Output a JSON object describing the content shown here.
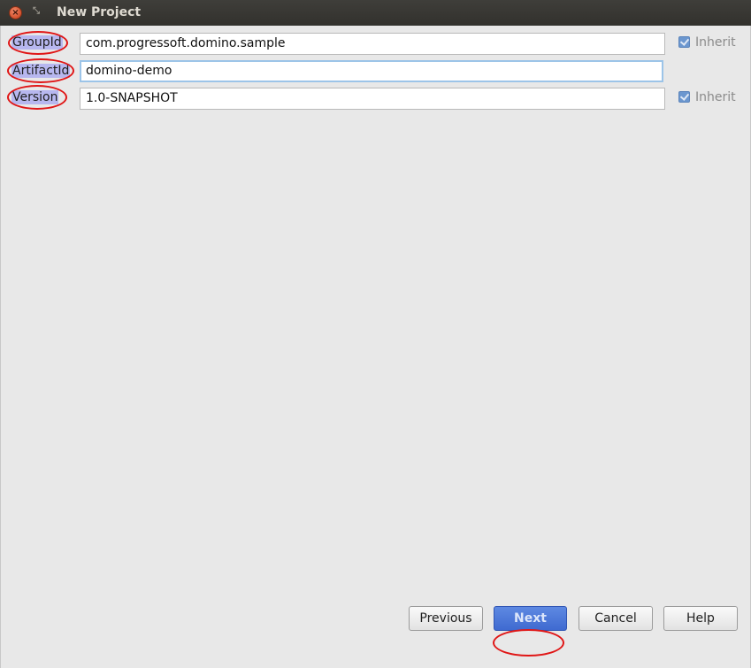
{
  "window": {
    "title": "New Project",
    "close_icon": "close-icon",
    "restore_icon": "restore-icon"
  },
  "form": {
    "group_label": "GroupId",
    "group_value": "com.progressoft.domino.sample",
    "artifact_label": "ArtifactId",
    "artifact_value": "domino-demo",
    "version_label": "Version",
    "version_value": "1.0-SNAPSHOT",
    "inherit_label": "Inherit",
    "group_inherit_checked": true,
    "version_inherit_checked": true
  },
  "buttons": {
    "previous": "Previous",
    "next": "Next",
    "cancel": "Cancel",
    "help": "Help"
  },
  "colors": {
    "annotation": "#e01616",
    "label_highlight": "#b7b7ef",
    "primary_button": "#4a75d8"
  }
}
